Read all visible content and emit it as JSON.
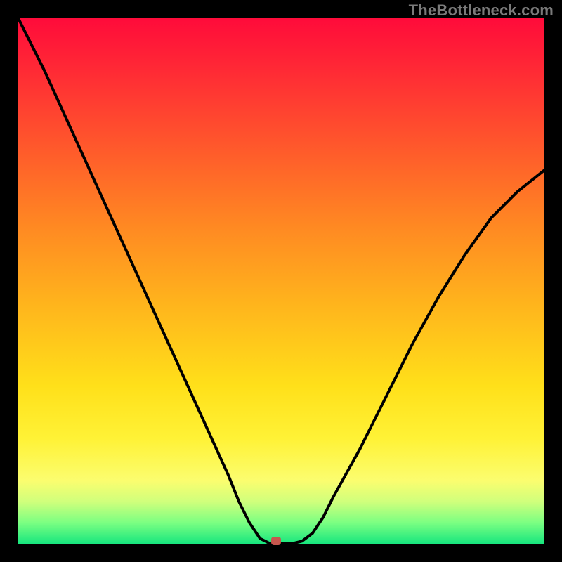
{
  "watermark": "TheBottleneck.com",
  "chart_data": {
    "type": "line",
    "title": "",
    "xlabel": "",
    "ylabel": "",
    "xlim": [
      0,
      100
    ],
    "ylim": [
      0,
      100
    ],
    "series": [
      {
        "name": "bottleneck-curve",
        "x": [
          0,
          5,
          10,
          15,
          20,
          25,
          30,
          35,
          40,
          42,
          44,
          46,
          48,
          50,
          52,
          54,
          56,
          58,
          60,
          65,
          70,
          75,
          80,
          85,
          90,
          95,
          100
        ],
        "values": [
          100,
          90,
          79,
          68,
          57,
          46,
          35,
          24,
          13,
          8,
          4,
          1,
          0,
          0,
          0,
          0.5,
          2,
          5,
          9,
          18,
          28,
          38,
          47,
          55,
          62,
          67,
          71
        ]
      }
    ],
    "marker": {
      "x": 49,
      "y": 0.5,
      "color": "#c6574e"
    },
    "background_gradient": {
      "direction": "vertical",
      "stops": [
        {
          "pos": 0,
          "color": "#ff0b3a"
        },
        {
          "pos": 25,
          "color": "#ff5a2b"
        },
        {
          "pos": 55,
          "color": "#ffb61c"
        },
        {
          "pos": 80,
          "color": "#fff236"
        },
        {
          "pos": 96,
          "color": "#7bff82"
        },
        {
          "pos": 100,
          "color": "#17e67e"
        }
      ]
    }
  }
}
